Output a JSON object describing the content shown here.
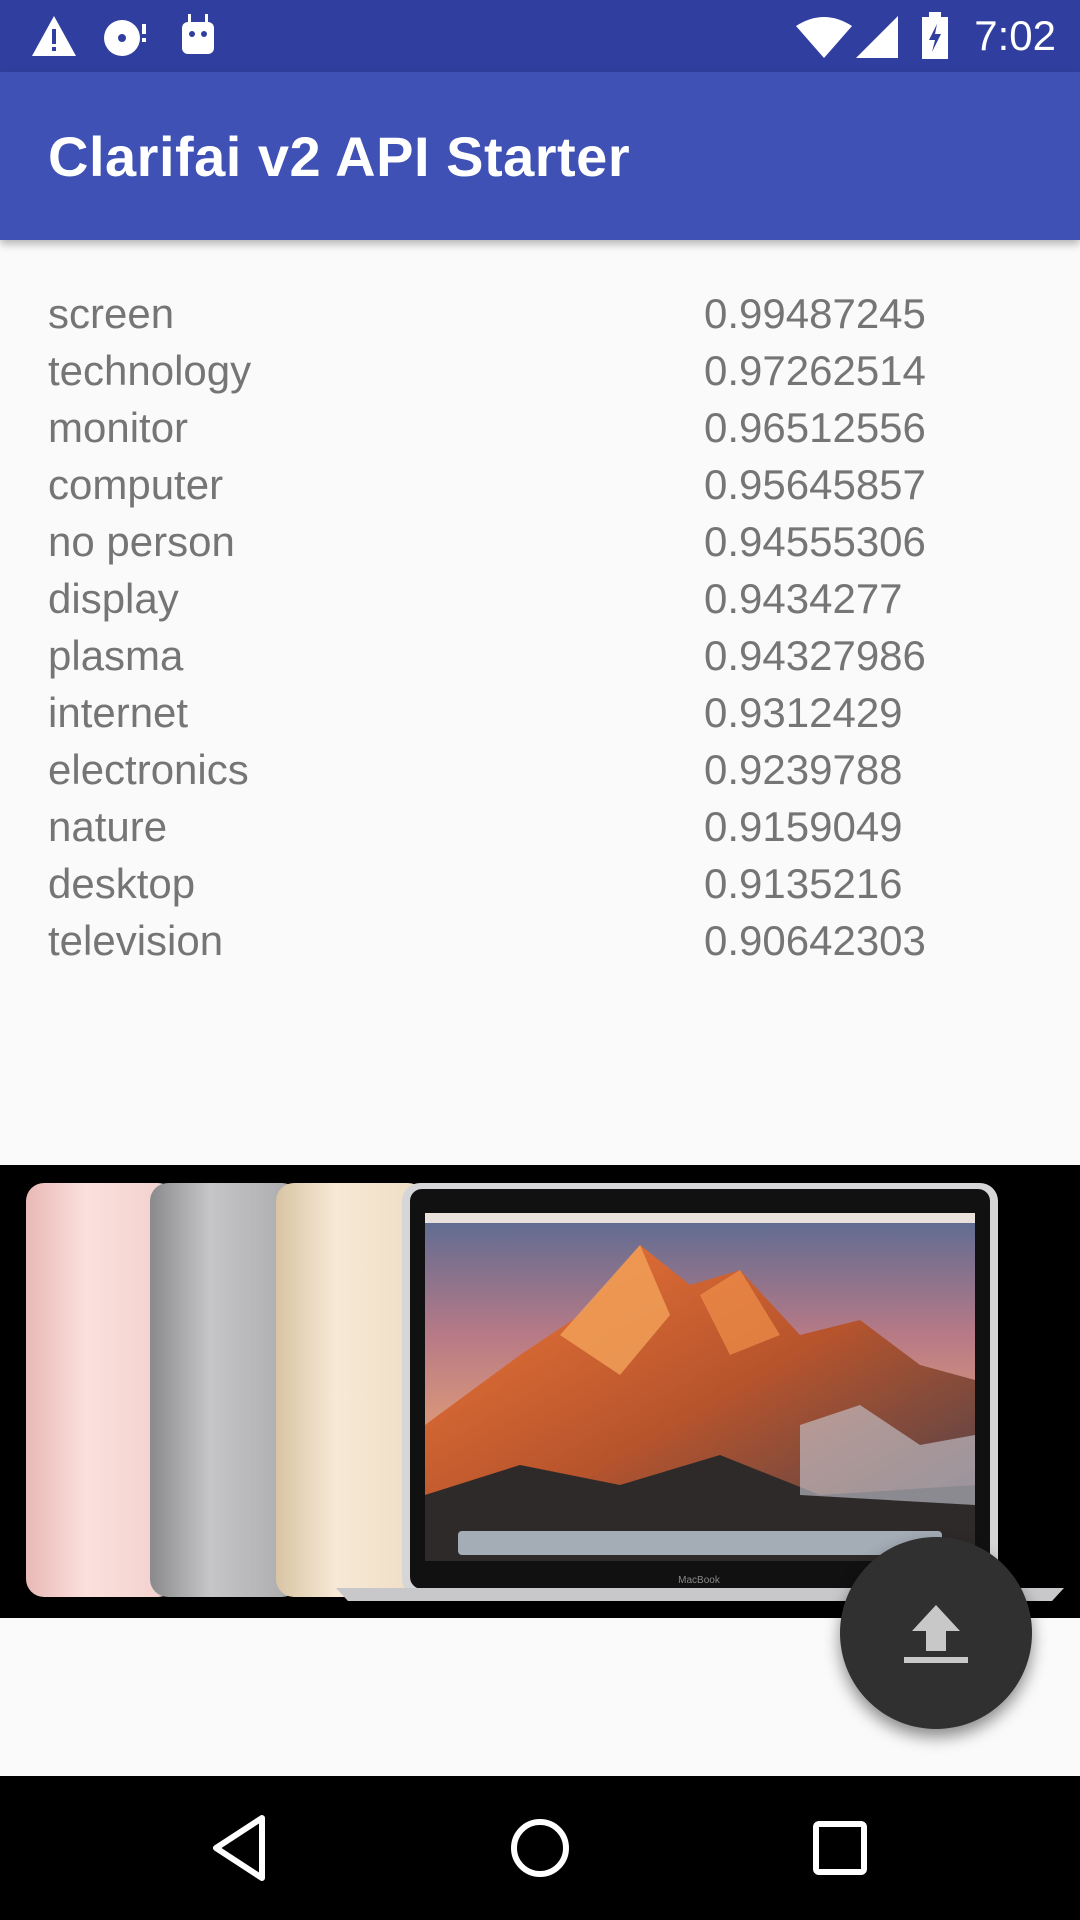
{
  "status_bar": {
    "time": "7:02",
    "icons": [
      "warning-icon",
      "disc-icon",
      "android-icon",
      "wifi-icon",
      "signal-icon",
      "battery-icon"
    ]
  },
  "app_bar": {
    "title": "Clarifai v2 API Starter",
    "color": "#3f51b5"
  },
  "concepts": [
    {
      "name": "screen",
      "value": "0.99487245"
    },
    {
      "name": "technology",
      "value": "0.97262514"
    },
    {
      "name": "monitor",
      "value": "0.96512556"
    },
    {
      "name": "computer",
      "value": "0.95645857"
    },
    {
      "name": "no person",
      "value": "0.94555306"
    },
    {
      "name": "display",
      "value": "0.9434277"
    },
    {
      "name": "plasma",
      "value": "0.94327986"
    },
    {
      "name": "internet",
      "value": "0.9312429"
    },
    {
      "name": "electronics",
      "value": "0.9239788"
    },
    {
      "name": "nature",
      "value": "0.9159049"
    },
    {
      "name": "desktop",
      "value": "0.9135216"
    },
    {
      "name": "television",
      "value": "0.90642303"
    }
  ],
  "image": {
    "laptop_brand": "MacBook"
  },
  "fab": {
    "icon": "upload-icon"
  },
  "nav_bar": {
    "icons": [
      "back-icon",
      "home-icon",
      "recents-icon"
    ]
  }
}
